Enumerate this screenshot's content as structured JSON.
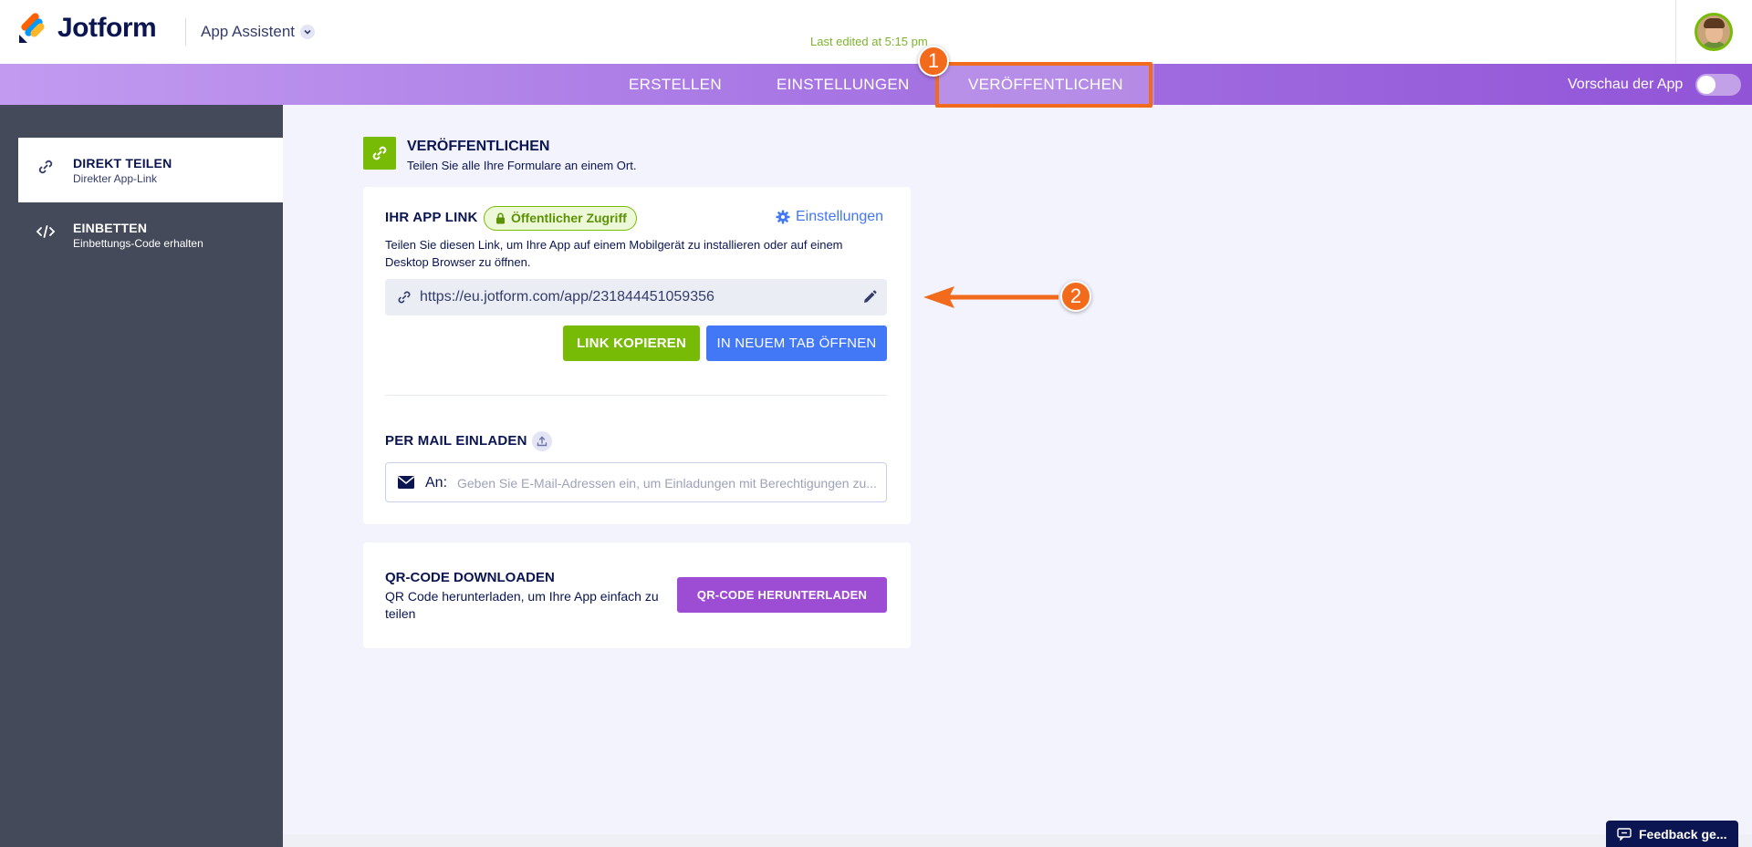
{
  "header": {
    "brand": "Jotform",
    "app_name": "App Assistent",
    "last_edited": "Last edited at 5:15 pm"
  },
  "nav": {
    "tabs": [
      {
        "label": "ERSTELLEN"
      },
      {
        "label": "EINSTELLUNGEN"
      },
      {
        "label": "VERÖFFENTLICHEN"
      }
    ],
    "preview_label": "Vorschau der App"
  },
  "annotations": {
    "step1": "1",
    "step2": "2",
    "highlight_color": "#f26a1b"
  },
  "sidebar": {
    "items": [
      {
        "title": "DIREKT TEILEN",
        "subtitle": "Direkter App-Link",
        "icon": "link-icon"
      },
      {
        "title": "EINBETTEN",
        "subtitle": "Einbettungs-Code erhalten",
        "icon": "code-icon"
      }
    ]
  },
  "section": {
    "title": "VERÖFFENTLICHEN",
    "subtitle": "Teilen Sie alle Ihre Formulare an einem Ort."
  },
  "app_link": {
    "label": "IHR APP LINK",
    "access_badge": "Öffentlicher Zugriff",
    "settings_label": "Einstellungen",
    "description": "Teilen Sie diesen Link, um Ihre App auf einem Mobilgerät zu installieren oder auf einem Desktop Browser zu öffnen.",
    "url": "https://eu.jotform.com/app/231844451059356",
    "copy_button": "LINK KOPIEREN",
    "open_button": "IN NEUEM TAB ÖFFNEN"
  },
  "mail_invite": {
    "label": "PER MAIL EINLADEN",
    "to_label": "An:",
    "placeholder": "Geben Sie E-Mail-Adressen ein, um Einladungen mit Berechtigungen zu..."
  },
  "qr": {
    "title": "QR-CODE DOWNLOADEN",
    "description": "QR Code herunterladen, um Ihre App einfach zu teilen",
    "button": "QR-CODE HERUNTERLADEN"
  },
  "feedback": {
    "label": "Feedback ge..."
  },
  "colors": {
    "brand_green": "#78bb07",
    "brand_blue": "#4277f5",
    "brand_purple": "#9c4dd3",
    "navy": "#0a1551"
  }
}
